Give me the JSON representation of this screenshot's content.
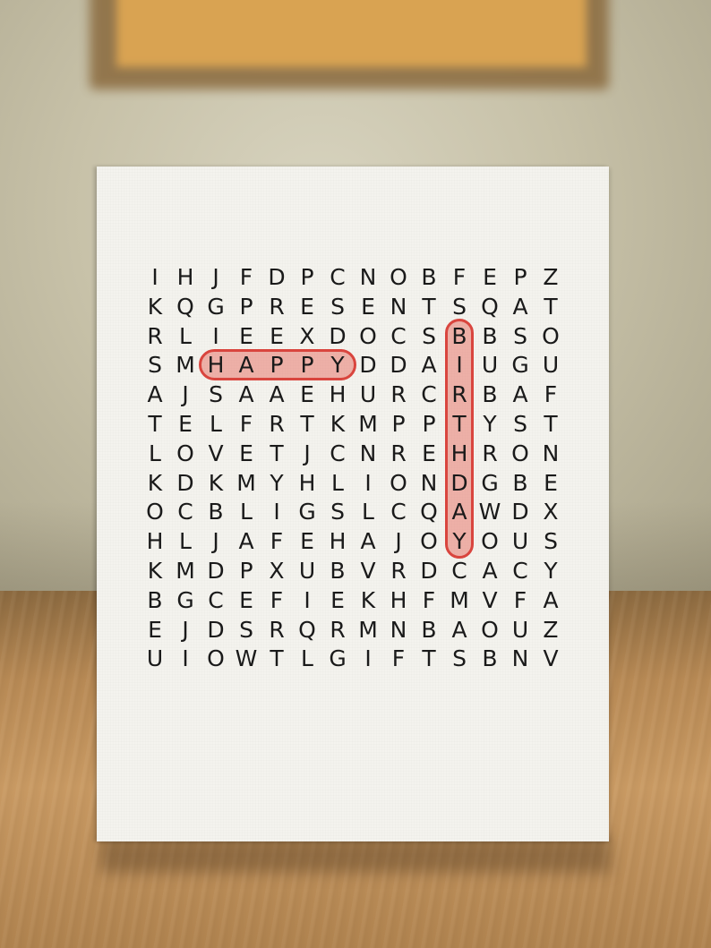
{
  "puzzle": {
    "rows": [
      "IHJFDPCNOBFEPZ",
      "KQGPRESENTSQAT",
      "RLIEEXDOCSBBSO",
      "SMHAPPYDDAIUGU",
      "AJSAAEHURCRBAF",
      "TELFRTKMPPTYST",
      "LOVETJCNREHRON",
      "KDKMYHLIONDGBE",
      "OCBLIGSLCQAWDX",
      "HLJAFEHAJOYOUS",
      "KMDPXUBVRDCACY",
      "BGCEFIEKHFMVFA",
      "EJDSRQRMNBAOUZ",
      "UIOWTLGIFTSBNV"
    ],
    "found_words": [
      {
        "word": "HAPPY",
        "direction": "horizontal",
        "row": 3,
        "col": 2
      },
      {
        "word": "BIRTHDAY",
        "direction": "vertical",
        "row": 2,
        "col": 10
      }
    ],
    "highlight_color": "#d9453e"
  }
}
